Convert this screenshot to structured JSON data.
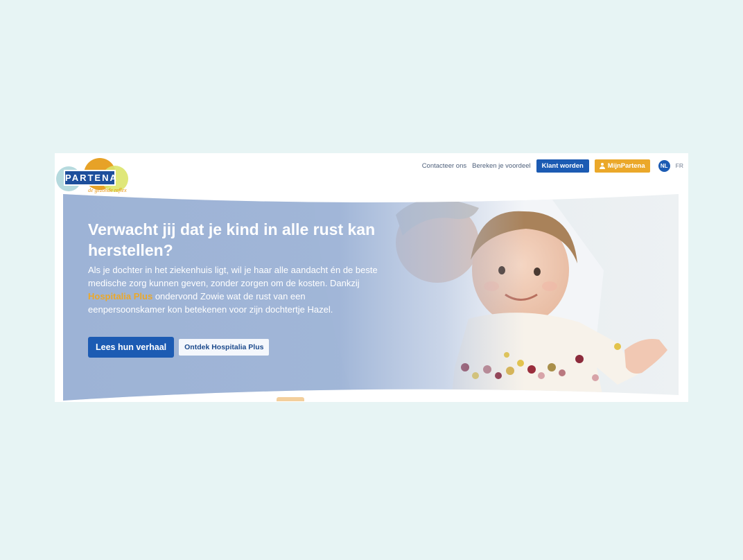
{
  "header": {
    "logo": {
      "brand": "PARTENA",
      "tagline": "de gezonde reflex"
    },
    "nav": {
      "contact": "Contacteer ons",
      "calculate": "Bereken je voordeel",
      "become_client": "Klant worden",
      "my_account": "MijnPartena"
    },
    "languages": {
      "active": "NL",
      "other": "FR"
    }
  },
  "hero": {
    "title": "Verwacht jij dat je kind in alle rust kan herstellen?",
    "body_part1": "Als je dochter in het ziekenhuis ligt, wil je haar alle aandacht én de beste medische zorg kunnen geven, zonder zorgen om de kosten. Dankzij ",
    "body_link": "Hospitalia Plus",
    "body_part2": " ondervond Zowie wat de rust van een eenpersoonskamer kon betekenen voor zijn dochtertje Hazel.",
    "primary_button": "Lees hun verhaal",
    "secondary_button": "Ontdek Hospitalia Plus"
  },
  "colors": {
    "page_background": "#e7f4f4",
    "brand_blue": "#1c5bb3",
    "brand_orange": "#eba82a",
    "hero_overlay": "#9db3d6"
  },
  "icons": {
    "account": "user-icon"
  }
}
